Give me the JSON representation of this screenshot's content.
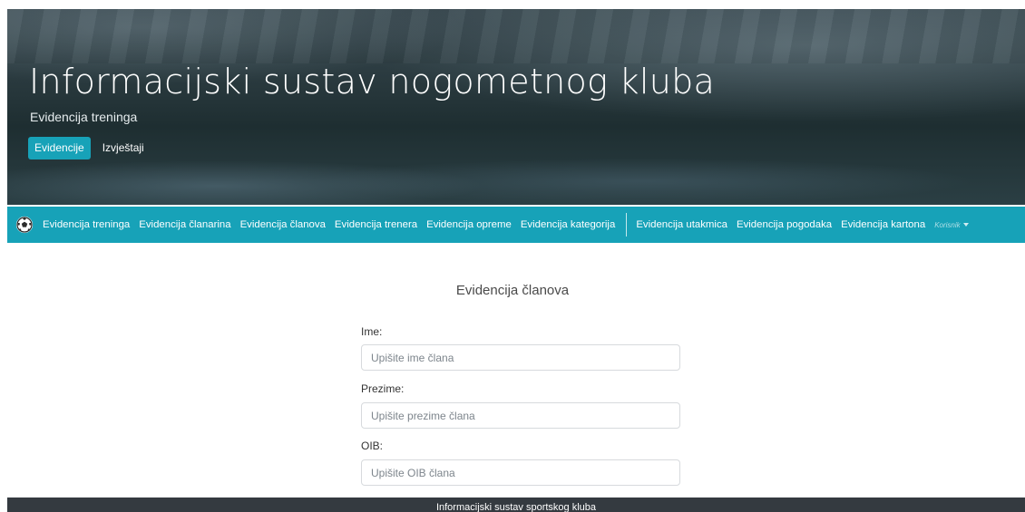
{
  "hero": {
    "title": "Informacijski sustav nogometnog kluba",
    "subtitle": "Evidencija treninga",
    "buttons": [
      {
        "label": "Evidencije",
        "active": true
      },
      {
        "label": "Izvještaji",
        "active": false
      }
    ]
  },
  "navbar": {
    "brand_icon": "soccer-ball-icon",
    "items_left": [
      "Evidencija treninga",
      "Evidencija članarina",
      "Evidencija članova",
      "Evidencija trenera",
      "Evidencija opreme",
      "Evidencija kategorija"
    ],
    "items_right": [
      "Evidencija utakmica",
      "Evidencija pogodaka",
      "Evidencija kartona"
    ],
    "user_label": "Korisnik",
    "color": "#17a2b8"
  },
  "main": {
    "heading": "Evidencija članova",
    "fields": [
      {
        "label": "Ime:",
        "placeholder": "Upišite ime člana",
        "value": ""
      },
      {
        "label": "Prezime:",
        "placeholder": "Upišite prezime člana",
        "value": ""
      },
      {
        "label": "OIB:",
        "placeholder": "Upišite OIB člana",
        "value": ""
      }
    ]
  },
  "footer": {
    "text": "Informacijski sustav sportskog kluba"
  }
}
